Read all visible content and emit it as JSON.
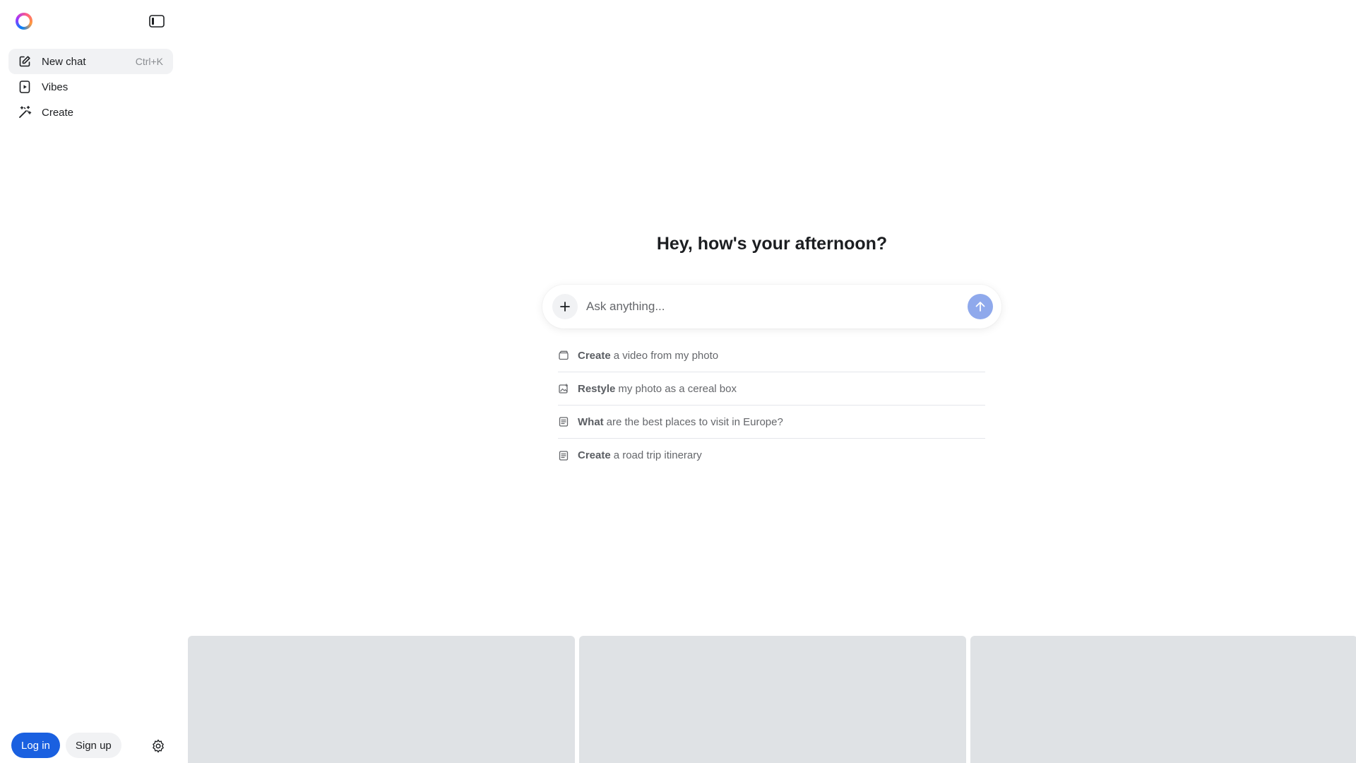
{
  "sidebar": {
    "logo": "meta-ai-logo",
    "collapse_icon": "sidebar-toggle-icon",
    "items": [
      {
        "label": "New chat",
        "shortcut": "Ctrl+K",
        "icon": "edit-icon",
        "active": true
      },
      {
        "label": "Vibes",
        "icon": "video-icon",
        "active": false
      },
      {
        "label": "Create",
        "icon": "sparkle-wand-icon",
        "active": false
      }
    ],
    "footer": {
      "login_label": "Log in",
      "signup_label": "Sign up",
      "settings_icon": "gear-icon"
    }
  },
  "main": {
    "greeting": "Hey, how's your afternoon?",
    "composer": {
      "placeholder": "Ask anything...",
      "add_icon": "plus-icon",
      "send_icon": "arrow-up-icon"
    },
    "suggestions": [
      {
        "bold": "Create",
        "rest": "a video from my photo",
        "icon": "video-clip-icon"
      },
      {
        "bold": "Restyle",
        "rest": "my photo as a cereal box",
        "icon": "image-edit-icon"
      },
      {
        "bold": "What",
        "rest": "are the best places to visit in Europe?",
        "icon": "document-icon"
      },
      {
        "bold": "Create",
        "rest": "a road trip itinerary",
        "icon": "document-icon"
      }
    ],
    "cards_count": 3
  },
  "colors": {
    "primary": "#1a60e0",
    "send_button": "#8fa9ec",
    "card_placeholder": "#dfe2e5",
    "active_item_bg": "#f1f2f4"
  }
}
